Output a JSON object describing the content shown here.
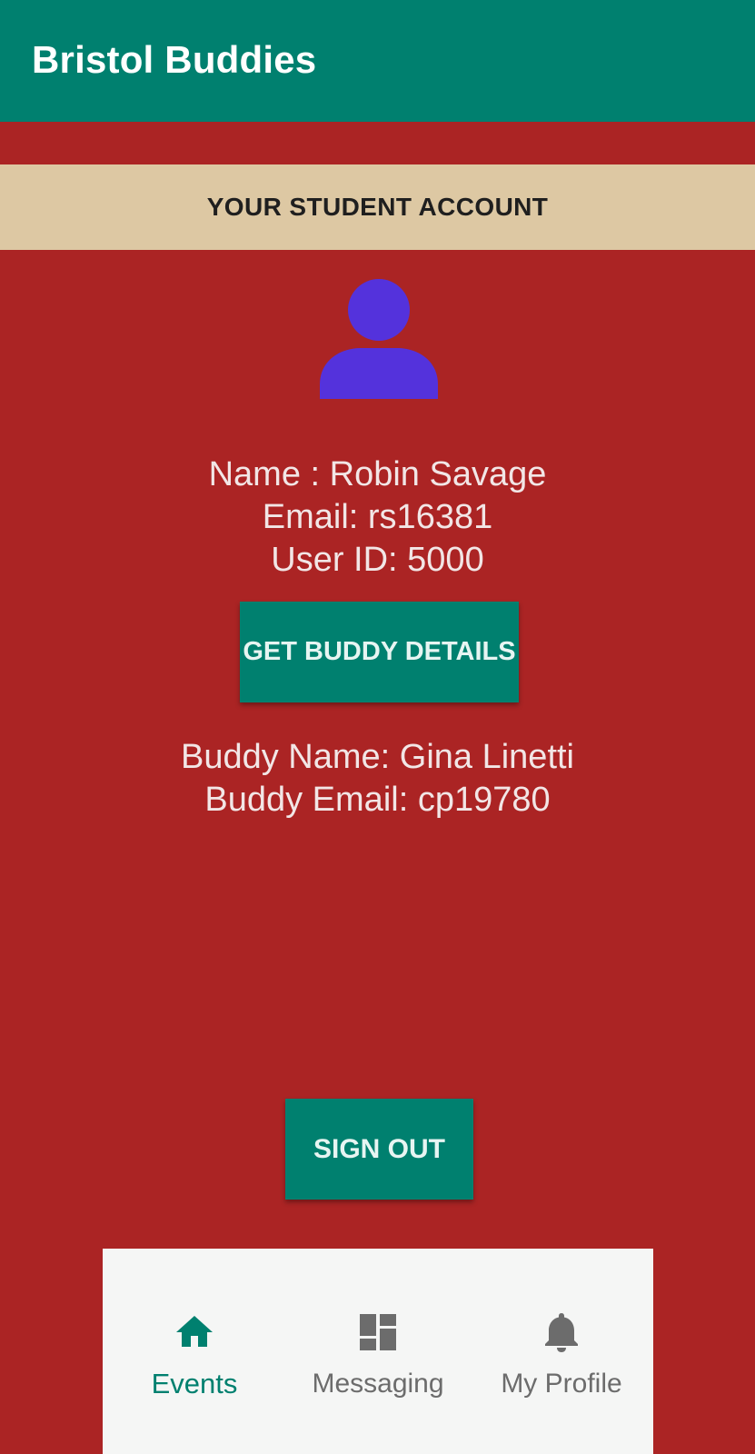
{
  "app": {
    "title": "Bristol Buddies"
  },
  "banner": {
    "label": "YOUR STUDENT ACCOUNT"
  },
  "user": {
    "name_line": "Name : Robin Savage",
    "email_line": "Email: rs16381",
    "id_line": "User ID: 5000"
  },
  "buttons": {
    "get_buddy": "GET BUDDY DETAILS",
    "sign_out": "SIGN OUT"
  },
  "buddy": {
    "name_line": "Buddy Name: Gina Linetti",
    "email_line": "Buddy Email: cp19780"
  },
  "nav": {
    "items": [
      {
        "label": "Events",
        "icon": "home-icon",
        "active": true
      },
      {
        "label": "Messaging",
        "icon": "dashboard-icon",
        "active": false
      },
      {
        "label": "My Profile",
        "icon": "bell-icon",
        "active": false
      }
    ]
  },
  "colors": {
    "background": "#ab2424",
    "primary": "#00806f",
    "banner": "#ddc8a3",
    "avatar": "#5432dc",
    "nav_background": "#f5f6f5"
  }
}
